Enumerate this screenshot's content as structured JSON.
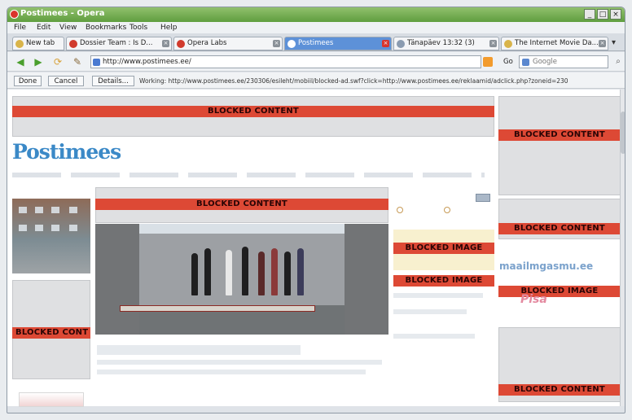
{
  "window": {
    "title": "Postimees - Opera",
    "controls": [
      "_",
      "□",
      "×"
    ]
  },
  "menu": [
    "File",
    "Edit",
    "View",
    "Bookmarks",
    "Tools",
    "Help"
  ],
  "tabs": [
    {
      "label": "New tab",
      "active": false
    },
    {
      "label": "Dossier Team : Is D...",
      "active": false
    },
    {
      "label": "Opera Labs",
      "active": false
    },
    {
      "label": "Postimees",
      "active": true
    },
    {
      "label": "Tänapäev 13:32 (3)",
      "active": false
    },
    {
      "label": "The Internet Movie Da...",
      "active": false
    }
  ],
  "nav": {
    "address": "http://www.postimees.ee/",
    "go": "Go",
    "search_placeholder": "Google"
  },
  "toolbar": {
    "done": "Done",
    "cancel": "Cancel",
    "details": "Details...",
    "status": "Working: http://www.postimees.ee/230306/esileht/mobiil/blocked-ad.swf?click=http://www.postimees.ee/reklaamid/adclick.php?zoneid=230"
  },
  "page": {
    "logo": "Postimees",
    "blocked_content": "BLOCKED CONTENT",
    "blocked_image": "BLOCKED IMAGE",
    "blocked_truncated": "BLOCKED CONT",
    "ad_text": "maailmgasmu.ee",
    "pink_text": "Pisa"
  }
}
